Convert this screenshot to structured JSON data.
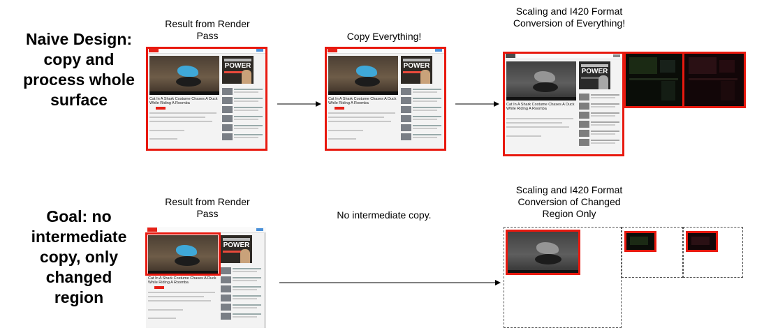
{
  "rows": {
    "naive": {
      "label": "Naive Design: copy and process whole surface",
      "cap_render": "Result from Render Pass",
      "cap_copy": "Copy Everything!",
      "cap_scale": "Scaling and I420 Format Conversion of Everything!"
    },
    "goal": {
      "label": "Goal: no intermediate copy, only changed region",
      "cap_render": "Result from Render Pass",
      "cap_copy": "No intermediate copy.",
      "cap_scale": "Scaling and I420 Format Conversion of Changed Region Only"
    }
  },
  "thumbnail": {
    "ad_text": "POWER",
    "video_title": "Cat In A Shark Costume Chases A Duck While Riding A Roomba"
  },
  "colors": {
    "highlight": "#e8190f",
    "arrow": "#000000",
    "dark_plane": "#0a0d08"
  }
}
